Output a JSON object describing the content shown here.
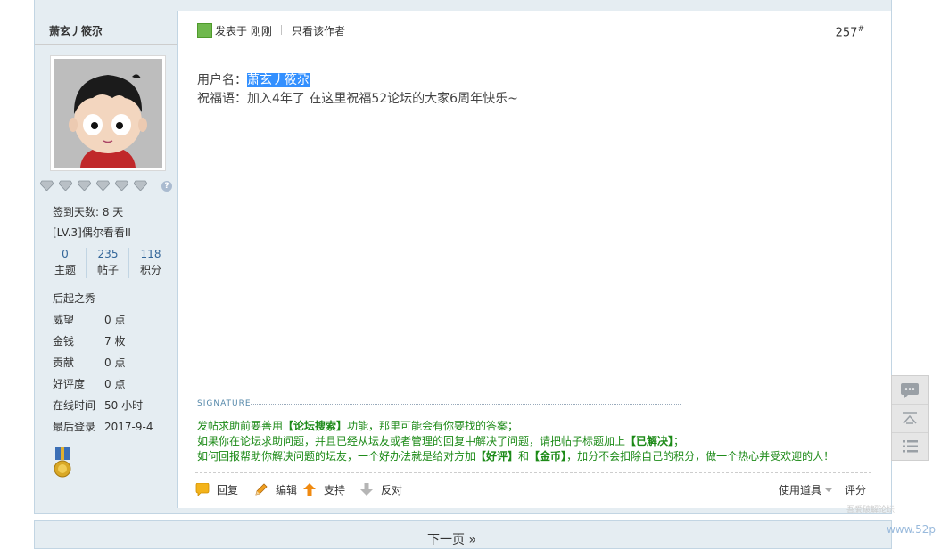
{
  "sidebar": {
    "username": "萧玄丿筱尕",
    "checkin": "签到天数: 8 天",
    "level": "[LV.3]偶尔看看II",
    "stats": [
      {
        "num": "0",
        "label": "主题"
      },
      {
        "num": "235",
        "label": "帖子"
      },
      {
        "num": "118",
        "label": "积分"
      }
    ],
    "group": "后起之秀",
    "fields": [
      {
        "k": "威望",
        "v": "0 点"
      },
      {
        "k": "金钱",
        "v": "7 枚"
      },
      {
        "k": "贡献",
        "v": "0 点"
      },
      {
        "k": "好评度",
        "v": "0 点"
      },
      {
        "k": "在线时间",
        "v": "50 小时"
      },
      {
        "k": "最后登录",
        "v": "2017-9-4"
      }
    ],
    "help_icon": "?"
  },
  "post": {
    "posted": "发表于 刚刚",
    "only_author": "只看该作者",
    "floor": "257",
    "floor_mark": "#",
    "line1_label": "用户名：",
    "line1_value": "萧玄丿筱尕",
    "line2": "祝福语：加入4年了 在这里祝福52论坛的大家6周年快乐~"
  },
  "signature": {
    "heading": "SIGNATURE",
    "l1a": "发帖求助前要善用",
    "l1b": "【论坛搜索】",
    "l1c": "功能，那里可能会有你要找的答案；",
    "l2a": "如果你在论坛求助问题，并且已经从坛友或者管理的回复中解决了问题，请把帖子标题加上",
    "l2b": "【已解决】",
    "l2c": "；",
    "l3a": "如何回报帮助你解决问题的坛友，一个好办法就是给对方加",
    "l3b": "【好评】",
    "l3c": "和",
    "l3d": "【金币】",
    "l3e": "，加分不会扣除自己的积分，做一个热心并受欢迎的人！"
  },
  "actions": {
    "reply": "回复",
    "edit": "编辑",
    "support": "支持",
    "oppose": "反对",
    "tools": "使用道具",
    "rate": "评分"
  },
  "pager": {
    "next": "下一页 »"
  },
  "watermark": {
    "text": "www.52p",
    "sub": "吾爱破解论坛"
  },
  "colors": {
    "accent": "#336699",
    "signature": "#1c8a17",
    "highlight": "#3390ff",
    "panel": "#e5edf2"
  }
}
